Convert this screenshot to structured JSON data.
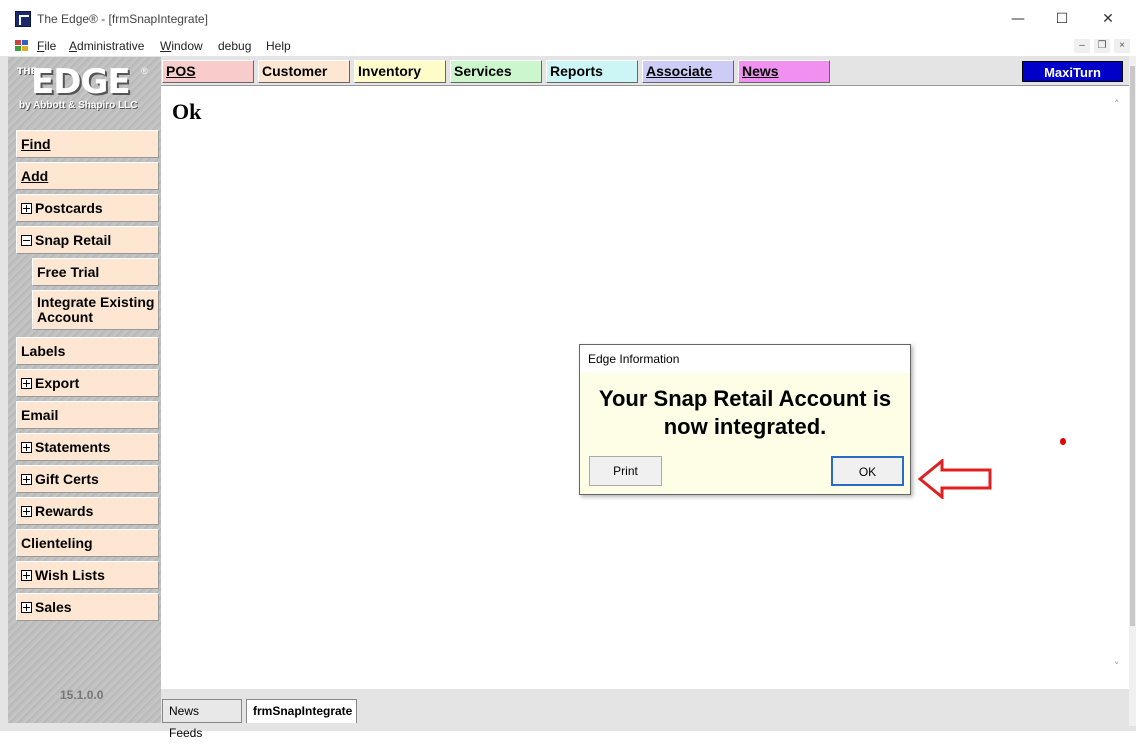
{
  "window": {
    "title": "The Edge® - [frmSnapIntegrate]",
    "controls": {
      "minimize": "—",
      "maximize": "☐",
      "close": "✕"
    }
  },
  "menubar": {
    "items": [
      {
        "label": "File",
        "mnemonic": "F"
      },
      {
        "label": "Administrative",
        "mnemonic": "A"
      },
      {
        "label": "Window",
        "mnemonic": "W"
      },
      {
        "label": "debug"
      },
      {
        "label": "Help"
      }
    ],
    "mdi_controls": {
      "minimize": "–",
      "restore": "❐",
      "close": "×"
    }
  },
  "logo": {
    "the": "THE",
    "edge": "EDGE",
    "reg": "®",
    "by": "by Abbott & Shapiro LLC"
  },
  "sidebar": {
    "items": [
      {
        "label": "Find",
        "expander": "none"
      },
      {
        "label": "Add",
        "expander": "none"
      },
      {
        "label": "Postcards",
        "expander": "plus"
      },
      {
        "label": "Snap Retail",
        "expander": "minus"
      },
      {
        "label": "Free Trial",
        "expander": "none",
        "child": true
      },
      {
        "label": "Integrate Existing Account",
        "expander": "none",
        "child": true
      },
      {
        "label": "Labels",
        "expander": "none"
      },
      {
        "label": "Export",
        "expander": "plus"
      },
      {
        "label": "Email",
        "expander": "none"
      },
      {
        "label": "Statements",
        "expander": "plus"
      },
      {
        "label": "Gift Certs",
        "expander": "plus"
      },
      {
        "label": "Rewards",
        "expander": "plus"
      },
      {
        "label": "Clienteling",
        "expander": "none"
      },
      {
        "label": "Wish Lists",
        "expander": "plus"
      },
      {
        "label": "Sales",
        "expander": "plus"
      }
    ],
    "version": "15.1.0.0"
  },
  "tabs": [
    {
      "label": "POS",
      "color": "#f9cccc"
    },
    {
      "label": "Customer",
      "color": "#fde6d2"
    },
    {
      "label": "Inventory",
      "color": "#fefcc8"
    },
    {
      "label": "Services",
      "color": "#ccf6cc"
    },
    {
      "label": "Reports",
      "color": "#ccf6f6"
    },
    {
      "label": "Associate",
      "color": "#ccccf6"
    },
    {
      "label": "News",
      "color": "#f090f0"
    }
  ],
  "maxiturn": {
    "label": "MaxiTurn"
  },
  "main": {
    "title": "Ok"
  },
  "bottom_tabs": [
    {
      "label": "News Feeds",
      "active": false
    },
    {
      "label": "frmSnapIntegrate",
      "active": true
    }
  ],
  "dialog": {
    "title": "Edge Information",
    "message_line1": "Your Snap Retail Account is",
    "message_line2": "now integrated.",
    "print_label": "Print",
    "ok_label": "OK"
  },
  "colors": {
    "accent": "#0000c8",
    "dialog_bg": "#fefee6",
    "annotation": "#e02020"
  }
}
